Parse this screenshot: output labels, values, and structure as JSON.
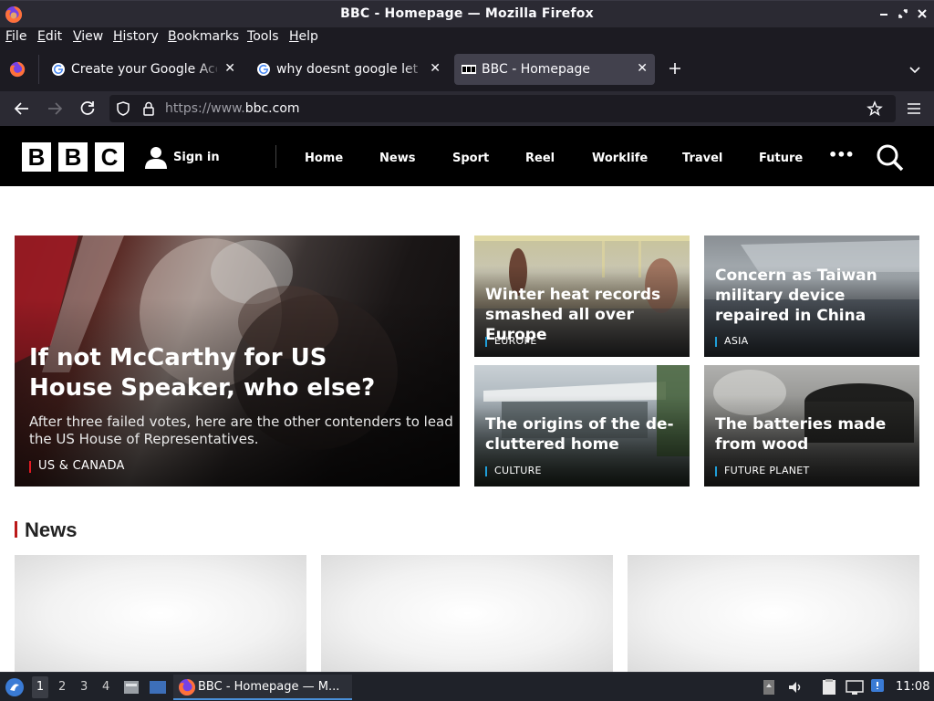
{
  "window": {
    "title": "BBC - Homepage — Mozilla Firefox"
  },
  "menu": {
    "items": [
      "File",
      "Edit",
      "View",
      "History",
      "Bookmarks",
      "Tools",
      "Help"
    ],
    "underlines": [
      "F",
      "E",
      "V",
      "H",
      "B",
      "T",
      "H"
    ]
  },
  "tabs": [
    {
      "label": "Create your Google Acco",
      "favicon": "google-icon",
      "active": false
    },
    {
      "label": "why doesnt google let m",
      "favicon": "google-icon",
      "active": false
    },
    {
      "label": "BBC - Homepage",
      "favicon": "bbc-icon",
      "active": true
    }
  ],
  "toolbar": {
    "url_prefix": "https://www.",
    "url_domain": "bbc.com"
  },
  "bbc": {
    "logo": [
      "B",
      "B",
      "C"
    ],
    "signin": "Sign in",
    "nav": [
      "Home",
      "News",
      "Sport",
      "Reel",
      "Worklife",
      "Travel",
      "Future"
    ],
    "more": "•••"
  },
  "stories": {
    "hero": {
      "headline": "If not McCarthy for US House Speaker, who else?",
      "summary": "After three failed votes, here are the other contenders to lead the US House of Representatives.",
      "tag": "US & CANADA"
    },
    "s1": {
      "headline": "Winter heat records smashed all over Europe",
      "tag": "EUROPE"
    },
    "s2": {
      "headline": "Concern as Taiwan military device repaired in China",
      "tag": "ASIA"
    },
    "s3": {
      "headline": "The origins of the de-cluttered home",
      "tag": "CULTURE"
    },
    "s4": {
      "headline": "The batteries made from wood",
      "tag": "FUTURE PLANET"
    }
  },
  "sections": {
    "news": "News"
  },
  "taskbar": {
    "workspaces": [
      "1",
      "2",
      "3",
      "4"
    ],
    "task_label": "BBC - Homepage — M...",
    "clock": "11:08"
  }
}
